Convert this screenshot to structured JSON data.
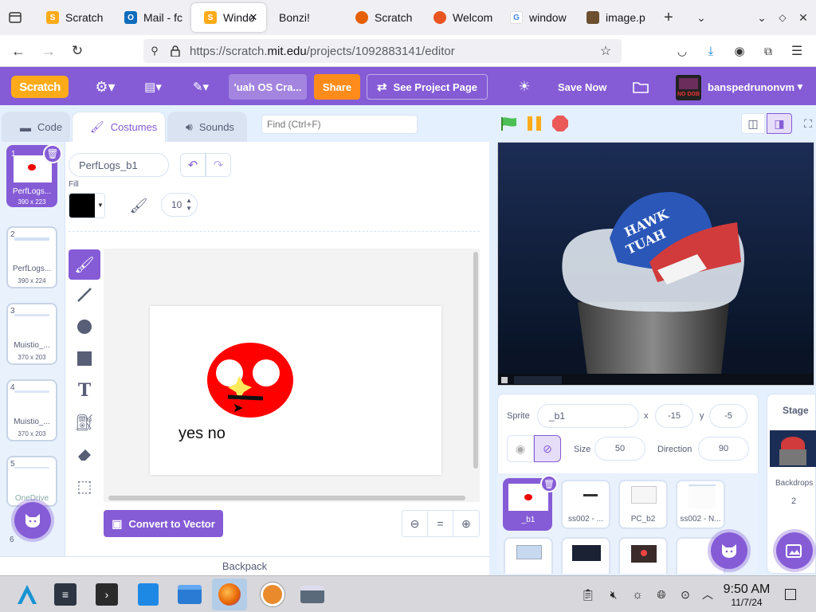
{
  "browser": {
    "tabs": [
      {
        "label": "Scratch",
        "icon": "scratch-favicon"
      },
      {
        "label": "Mail - fc",
        "icon": "outlook-favicon"
      },
      {
        "label": "Windo",
        "icon": "scratch-favicon",
        "active": true
      },
      {
        "label": "Bonzi!",
        "icon": ""
      },
      {
        "label": "Scratch",
        "icon": "firefox-favicon"
      },
      {
        "label": "Welcom",
        "icon": "ubuntu-favicon"
      },
      {
        "label": "window",
        "icon": "google-favicon"
      },
      {
        "label": "image.p",
        "icon": "image-favicon"
      }
    ],
    "url_prefix": "https://scratch.",
    "url_domain": "mit.edu",
    "url_path": "/projects/1092883141/editor"
  },
  "scratch": {
    "logo": "Scratch",
    "project_title": "'uah OS Cra...",
    "share_label": "Share",
    "see_project_label": "See Project Page",
    "save_now_label": "Save Now",
    "username": "banspedrunonvm",
    "avatar_text": "NO DOB"
  },
  "editor": {
    "tabs": {
      "code": "Code",
      "costumes": "Costumes",
      "sounds": "Sounds"
    },
    "find_placeholder": "Find (Ctrl+F)",
    "costume_name": "PerfLogs_b1",
    "fill_label": "Fill",
    "fill_color": "#000000",
    "brush_size": "10",
    "convert_label": "Convert to Vector",
    "canvas_text": "yes no",
    "backpack_label": "Backpack",
    "costumes": [
      {
        "num": "1",
        "name": "PerfLogs...",
        "size": "390 x 223"
      },
      {
        "num": "2",
        "name": "PerfLogs...",
        "size": "390 x 224"
      },
      {
        "num": "3",
        "name": "Muistio_...",
        "size": "370 x 203"
      },
      {
        "num": "4",
        "name": "Muistio_...",
        "size": "370 x 203"
      },
      {
        "num": "5",
        "name": "OneDrive",
        "size": ""
      },
      {
        "num": "6",
        "name": "",
        "size": ""
      }
    ]
  },
  "sprite": {
    "sprite_label": "Sprite",
    "name": "_b1",
    "x_label": "x",
    "x": "-15",
    "y_label": "y",
    "y": "-5",
    "size_label": "Size",
    "size": "50",
    "direction_label": "Direction",
    "direction": "90",
    "sprites": [
      "_b1",
      "ss002 - ...",
      "PC_b2",
      "ss002 - N..."
    ],
    "sprites_row2": [
      "",
      "",
      "",
      ""
    ]
  },
  "stage_panel": {
    "title": "Stage",
    "backdrops_label": "Backdrops",
    "backdrops_count": "2"
  },
  "stage_scene": {
    "cap_text_1": "HAWK",
    "cap_text_2": "TUAH"
  },
  "taskbar": {
    "time": "9:50 AM",
    "date": "11/7/24"
  },
  "colors": {
    "scratch_purple": "#855cd6",
    "share_orange": "#ff8c1a",
    "stage_bg": "#101a33"
  }
}
